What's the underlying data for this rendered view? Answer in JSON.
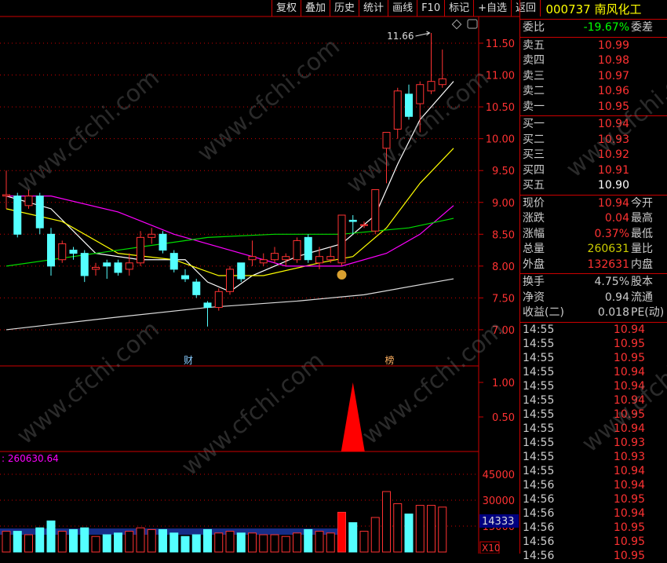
{
  "toolbar": [
    "复权",
    "叠加",
    "历史",
    "统计",
    "画线",
    "F10",
    "标记",
    "+自选",
    "返回"
  ],
  "stock": {
    "code": "000737",
    "name": "南风化工"
  },
  "weibi": {
    "label": "委比",
    "value": "-19.67%",
    "right": "委差"
  },
  "sell": [
    {
      "l": "卖五",
      "v": "10.99"
    },
    {
      "l": "卖四",
      "v": "10.98"
    },
    {
      "l": "卖三",
      "v": "10.97"
    },
    {
      "l": "卖二",
      "v": "10.96"
    },
    {
      "l": "卖一",
      "v": "10.95"
    }
  ],
  "buy": [
    {
      "l": "买一",
      "v": "10.94"
    },
    {
      "l": "买二",
      "v": "10.93"
    },
    {
      "l": "买三",
      "v": "10.92"
    },
    {
      "l": "买四",
      "v": "10.91"
    },
    {
      "l": "买五",
      "v": "10.90"
    }
  ],
  "quote": [
    {
      "l": "现价",
      "v": "10.94",
      "r": "今开",
      "c": "red"
    },
    {
      "l": "涨跌",
      "v": "0.04",
      "r": "最高",
      "c": "red"
    },
    {
      "l": "涨幅",
      "v": "0.37%",
      "r": "最低",
      "c": "red"
    },
    {
      "l": "总量",
      "v": "260631",
      "r": "量比",
      "c": "yel"
    },
    {
      "l": "外盘",
      "v": "132631",
      "r": "内盘",
      "c": "red"
    }
  ],
  "fund": [
    {
      "l": "换手",
      "v": "4.75%",
      "r": "股本"
    },
    {
      "l": "净资",
      "v": "0.94",
      "r": "流通"
    },
    {
      "l": "收益(二)",
      "v": "0.018",
      "r": "PE(动)"
    }
  ],
  "ticks": [
    [
      "14:55",
      "10.94"
    ],
    [
      "14:55",
      "10.95"
    ],
    [
      "14:55",
      "10.95"
    ],
    [
      "14:55",
      "10.94"
    ],
    [
      "14:55",
      "10.94"
    ],
    [
      "14:55",
      "10.94"
    ],
    [
      "14:55",
      "10.95"
    ],
    [
      "14:55",
      "10.94"
    ],
    [
      "14:55",
      "10.93"
    ],
    [
      "14:55",
      "10.93"
    ],
    [
      "14:55",
      "10.94"
    ],
    [
      "14:56",
      "10.94"
    ],
    [
      "14:56",
      "10.95"
    ],
    [
      "14:56",
      "10.94"
    ],
    [
      "14:56",
      "10.95"
    ],
    [
      "14:56",
      "10.95"
    ],
    [
      "14:56",
      "10.95"
    ]
  ],
  "watermark": "www.cfchi.com",
  "chart_data": {
    "type": "candlestick",
    "price_ticks": [
      "11.50",
      "11.00",
      "10.50",
      "10.00",
      "9.50",
      "9.00",
      "8.50",
      "8.00",
      "7.50",
      "7.00"
    ],
    "ylim": [
      7.0,
      11.5
    ],
    "high_label": "11.66",
    "markers": [
      {
        "text": "财",
        "index": 16
      },
      {
        "text": "榜",
        "index": 34
      }
    ],
    "candles": [
      [
        9.1,
        9.12,
        9.5,
        8.9
      ],
      [
        9.1,
        8.5,
        9.15,
        8.45
      ],
      [
        8.95,
        9.1,
        9.2,
        8.9
      ],
      [
        9.1,
        8.6,
        9.15,
        8.5
      ],
      [
        8.5,
        8.0,
        8.6,
        7.85
      ],
      [
        8.1,
        8.35,
        8.4,
        8.05
      ],
      [
        8.25,
        8.2,
        8.3,
        8.1
      ],
      [
        8.2,
        7.85,
        8.25,
        7.75
      ],
      [
        7.95,
        7.98,
        8.05,
        7.85
      ],
      [
        8.05,
        8.0,
        8.1,
        7.8
      ],
      [
        8.05,
        7.9,
        8.1,
        7.85
      ],
      [
        7.95,
        8.05,
        8.2,
        7.85
      ],
      [
        8.05,
        8.45,
        8.55,
        8.0
      ],
      [
        8.45,
        8.5,
        8.6,
        8.35
      ],
      [
        8.5,
        8.25,
        8.55,
        8.2
      ],
      [
        8.2,
        7.95,
        8.25,
        7.9
      ],
      [
        7.85,
        7.8,
        7.95,
        7.75
      ],
      [
        7.75,
        7.55,
        7.8,
        7.5
      ],
      [
        7.42,
        7.35,
        7.45,
        7.05
      ],
      [
        7.35,
        7.6,
        7.65,
        7.3
      ],
      [
        7.6,
        7.95,
        8.0,
        7.55
      ],
      [
        8.05,
        7.8,
        8.05,
        7.75
      ],
      [
        8.1,
        8.15,
        8.4,
        8.0
      ],
      [
        8.05,
        8.1,
        8.2,
        8.0
      ],
      [
        8.1,
        8.2,
        8.3,
        8.05
      ],
      [
        8.1,
        8.15,
        8.2,
        8.0
      ],
      [
        8.1,
        8.4,
        8.45,
        8.05
      ],
      [
        8.45,
        8.1,
        8.5,
        8.05
      ],
      [
        8.05,
        8.15,
        8.3,
        7.95
      ],
      [
        8.1,
        8.15,
        8.3,
        8.05
      ],
      [
        8.05,
        8.8,
        8.8,
        8.0
      ],
      [
        8.72,
        8.7,
        8.8,
        8.5
      ],
      [
        8.65,
        8.65,
        8.7,
        8.6
      ],
      [
        8.55,
        9.2,
        9.2,
        8.5
      ],
      [
        9.85,
        10.1,
        10.1,
        9.3
      ],
      [
        10.15,
        10.75,
        10.8,
        10.0
      ],
      [
        10.7,
        10.35,
        10.85,
        10.3
      ],
      [
        10.55,
        10.85,
        10.9,
        10.1
      ],
      [
        10.75,
        10.9,
        11.66,
        10.7
      ],
      [
        10.85,
        10.94,
        11.4,
        10.8
      ]
    ],
    "ma": [
      {
        "name": "MA5",
        "color": "#ffffff",
        "pts": [
          [
            0,
            9.1
          ],
          [
            4,
            8.9
          ],
          [
            8,
            8.2
          ],
          [
            12,
            8.1
          ],
          [
            16,
            8.1
          ],
          [
            18,
            7.75
          ],
          [
            20,
            7.6
          ],
          [
            22,
            7.85
          ],
          [
            26,
            8.15
          ],
          [
            30,
            8.35
          ],
          [
            33,
            8.8
          ],
          [
            35,
            9.6
          ],
          [
            37,
            10.3
          ],
          [
            40,
            10.9
          ]
        ]
      },
      {
        "name": "MA10",
        "color": "#ffff00",
        "pts": [
          [
            0,
            8.9
          ],
          [
            5,
            8.7
          ],
          [
            10,
            8.2
          ],
          [
            15,
            8.1
          ],
          [
            19,
            7.85
          ],
          [
            23,
            7.85
          ],
          [
            28,
            8.05
          ],
          [
            31,
            8.15
          ],
          [
            34,
            8.6
          ],
          [
            37,
            9.3
          ],
          [
            40,
            9.85
          ]
        ]
      },
      {
        "name": "MA20",
        "color": "#ff00ff",
        "pts": [
          [
            0,
            9.1
          ],
          [
            4,
            9.1
          ],
          [
            10,
            8.85
          ],
          [
            15,
            8.5
          ],
          [
            20,
            8.25
          ],
          [
            25,
            8.0
          ],
          [
            30,
            8.0
          ],
          [
            34,
            8.2
          ],
          [
            37,
            8.5
          ],
          [
            40,
            8.95
          ]
        ]
      },
      {
        "name": "MA30",
        "color": "#00dd00",
        "pts": [
          [
            0,
            8.0
          ],
          [
            6,
            8.15
          ],
          [
            12,
            8.3
          ],
          [
            18,
            8.45
          ],
          [
            24,
            8.5
          ],
          [
            30,
            8.5
          ],
          [
            36,
            8.6
          ],
          [
            40,
            8.75
          ]
        ]
      },
      {
        "name": "MA60",
        "color": "#dddddd",
        "pts": [
          [
            0,
            7.0
          ],
          [
            10,
            7.2
          ],
          [
            18,
            7.35
          ],
          [
            26,
            7.45
          ],
          [
            32,
            7.55
          ],
          [
            40,
            7.8
          ]
        ]
      }
    ],
    "indicator": {
      "ticks": [
        "1.00",
        "0.50"
      ],
      "signal_index": 31,
      "signal_value": 1.0
    },
    "volume": {
      "label": ": 260630.64",
      "ticks": [
        "45000",
        "30000",
        "15000"
      ],
      "current": "14333",
      "unit": "X10",
      "values": [
        12000,
        12000,
        10000,
        14000,
        18000,
        12000,
        13000,
        14000,
        9000,
        10000,
        11000,
        12000,
        14000,
        13000,
        13000,
        11000,
        9000,
        10000,
        13000,
        11000,
        12000,
        11000,
        11000,
        10000,
        10000,
        9000,
        11000,
        13000,
        12000,
        11000,
        23000,
        17000,
        12000,
        20000,
        35000,
        28000,
        22000,
        27000,
        27000,
        26000
      ]
    }
  }
}
